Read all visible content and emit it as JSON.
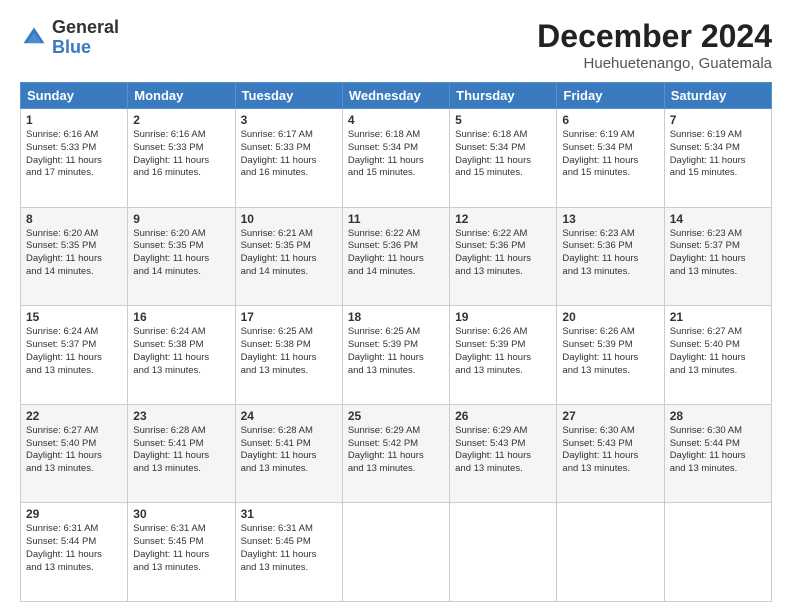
{
  "logo": {
    "line1": "General",
    "line2": "Blue"
  },
  "title": "December 2024",
  "subtitle": "Huehuetenango, Guatemala",
  "days_of_week": [
    "Sunday",
    "Monday",
    "Tuesday",
    "Wednesday",
    "Thursday",
    "Friday",
    "Saturday"
  ],
  "weeks": [
    [
      {
        "day": "1",
        "info": "Sunrise: 6:16 AM\nSunset: 5:33 PM\nDaylight: 11 hours\nand 17 minutes."
      },
      {
        "day": "2",
        "info": "Sunrise: 6:16 AM\nSunset: 5:33 PM\nDaylight: 11 hours\nand 16 minutes."
      },
      {
        "day": "3",
        "info": "Sunrise: 6:17 AM\nSunset: 5:33 PM\nDaylight: 11 hours\nand 16 minutes."
      },
      {
        "day": "4",
        "info": "Sunrise: 6:18 AM\nSunset: 5:34 PM\nDaylight: 11 hours\nand 15 minutes."
      },
      {
        "day": "5",
        "info": "Sunrise: 6:18 AM\nSunset: 5:34 PM\nDaylight: 11 hours\nand 15 minutes."
      },
      {
        "day": "6",
        "info": "Sunrise: 6:19 AM\nSunset: 5:34 PM\nDaylight: 11 hours\nand 15 minutes."
      },
      {
        "day": "7",
        "info": "Sunrise: 6:19 AM\nSunset: 5:34 PM\nDaylight: 11 hours\nand 15 minutes."
      }
    ],
    [
      {
        "day": "8",
        "info": "Sunrise: 6:20 AM\nSunset: 5:35 PM\nDaylight: 11 hours\nand 14 minutes."
      },
      {
        "day": "9",
        "info": "Sunrise: 6:20 AM\nSunset: 5:35 PM\nDaylight: 11 hours\nand 14 minutes."
      },
      {
        "day": "10",
        "info": "Sunrise: 6:21 AM\nSunset: 5:35 PM\nDaylight: 11 hours\nand 14 minutes."
      },
      {
        "day": "11",
        "info": "Sunrise: 6:22 AM\nSunset: 5:36 PM\nDaylight: 11 hours\nand 14 minutes."
      },
      {
        "day": "12",
        "info": "Sunrise: 6:22 AM\nSunset: 5:36 PM\nDaylight: 11 hours\nand 13 minutes."
      },
      {
        "day": "13",
        "info": "Sunrise: 6:23 AM\nSunset: 5:36 PM\nDaylight: 11 hours\nand 13 minutes."
      },
      {
        "day": "14",
        "info": "Sunrise: 6:23 AM\nSunset: 5:37 PM\nDaylight: 11 hours\nand 13 minutes."
      }
    ],
    [
      {
        "day": "15",
        "info": "Sunrise: 6:24 AM\nSunset: 5:37 PM\nDaylight: 11 hours\nand 13 minutes."
      },
      {
        "day": "16",
        "info": "Sunrise: 6:24 AM\nSunset: 5:38 PM\nDaylight: 11 hours\nand 13 minutes."
      },
      {
        "day": "17",
        "info": "Sunrise: 6:25 AM\nSunset: 5:38 PM\nDaylight: 11 hours\nand 13 minutes."
      },
      {
        "day": "18",
        "info": "Sunrise: 6:25 AM\nSunset: 5:39 PM\nDaylight: 11 hours\nand 13 minutes."
      },
      {
        "day": "19",
        "info": "Sunrise: 6:26 AM\nSunset: 5:39 PM\nDaylight: 11 hours\nand 13 minutes."
      },
      {
        "day": "20",
        "info": "Sunrise: 6:26 AM\nSunset: 5:39 PM\nDaylight: 11 hours\nand 13 minutes."
      },
      {
        "day": "21",
        "info": "Sunrise: 6:27 AM\nSunset: 5:40 PM\nDaylight: 11 hours\nand 13 minutes."
      }
    ],
    [
      {
        "day": "22",
        "info": "Sunrise: 6:27 AM\nSunset: 5:40 PM\nDaylight: 11 hours\nand 13 minutes."
      },
      {
        "day": "23",
        "info": "Sunrise: 6:28 AM\nSunset: 5:41 PM\nDaylight: 11 hours\nand 13 minutes."
      },
      {
        "day": "24",
        "info": "Sunrise: 6:28 AM\nSunset: 5:41 PM\nDaylight: 11 hours\nand 13 minutes."
      },
      {
        "day": "25",
        "info": "Sunrise: 6:29 AM\nSunset: 5:42 PM\nDaylight: 11 hours\nand 13 minutes."
      },
      {
        "day": "26",
        "info": "Sunrise: 6:29 AM\nSunset: 5:43 PM\nDaylight: 11 hours\nand 13 minutes."
      },
      {
        "day": "27",
        "info": "Sunrise: 6:30 AM\nSunset: 5:43 PM\nDaylight: 11 hours\nand 13 minutes."
      },
      {
        "day": "28",
        "info": "Sunrise: 6:30 AM\nSunset: 5:44 PM\nDaylight: 11 hours\nand 13 minutes."
      }
    ],
    [
      {
        "day": "29",
        "info": "Sunrise: 6:31 AM\nSunset: 5:44 PM\nDaylight: 11 hours\nand 13 minutes."
      },
      {
        "day": "30",
        "info": "Sunrise: 6:31 AM\nSunset: 5:45 PM\nDaylight: 11 hours\nand 13 minutes."
      },
      {
        "day": "31",
        "info": "Sunrise: 6:31 AM\nSunset: 5:45 PM\nDaylight: 11 hours\nand 13 minutes."
      },
      {
        "day": "",
        "info": ""
      },
      {
        "day": "",
        "info": ""
      },
      {
        "day": "",
        "info": ""
      },
      {
        "day": "",
        "info": ""
      }
    ]
  ]
}
